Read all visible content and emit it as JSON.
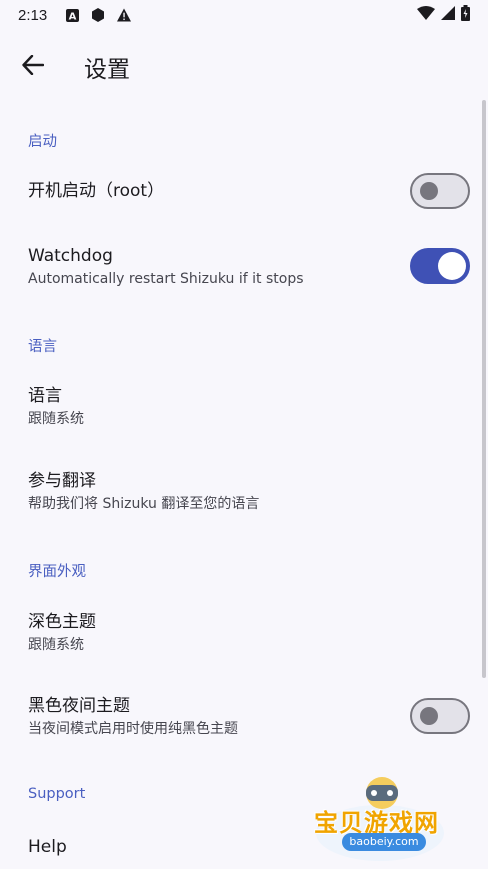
{
  "status_bar": {
    "time": "2:13",
    "icons": [
      "notification-a-icon",
      "shield-icon",
      "warning-icon"
    ],
    "right_icons": [
      "wifi-icon",
      "cellular-icon",
      "battery-icon"
    ]
  },
  "app_bar": {
    "title": "设置",
    "back_icon": "arrow-back-icon"
  },
  "sections": {
    "startup": {
      "header": "启动",
      "boot": {
        "title": "开机启动（root）",
        "toggle_on": false
      },
      "watchdog": {
        "title": "Watchdog",
        "summary": "Automatically restart Shizuku if it stops",
        "toggle_on": true
      }
    },
    "language": {
      "header": "语言",
      "lang": {
        "title": "语言",
        "summary": "跟随系统"
      },
      "translate": {
        "title": "参与翻译",
        "summary": "帮助我们将 Shizuku 翻译至您的语言"
      }
    },
    "appearance": {
      "header": "界面外观",
      "dark_theme": {
        "title": "深色主题",
        "summary": "跟随系统"
      },
      "black_night": {
        "title": "黑色夜间主题",
        "summary": "当夜间模式启用时使用纯黑色主题",
        "toggle_on": false
      }
    },
    "support": {
      "header": "Support",
      "help": {
        "title": "Help"
      }
    }
  },
  "watermark": {
    "text": "宝贝游戏网",
    "url": "baobeiy.com"
  },
  "colors": {
    "accent": "#3f51b5",
    "section_header": "#4a5fc1",
    "background": "#f8f7fc"
  }
}
